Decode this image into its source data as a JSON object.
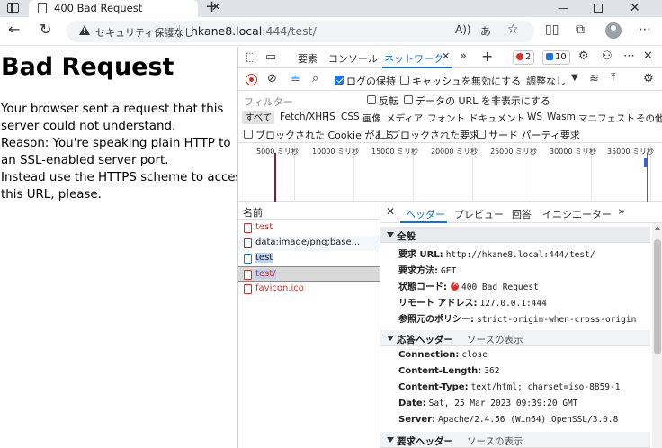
{
  "browser": {
    "tab_title": "400 Bad Request",
    "security_label": "セキュリティ保護なし",
    "url_host": "hkane8.local",
    "url_rest": ":444/test/"
  },
  "page": {
    "heading": "Bad Request",
    "lines": [
      "Your browser sent a request that this",
      "server could not understand.",
      "Reason: You're speaking plain HTTP to",
      "an SSL-enabled server port.",
      "Instead use the HTTPS scheme to access",
      "this URL, please."
    ]
  },
  "devtools": {
    "tabs": [
      "要素",
      "コンソール",
      "ネットワーク"
    ],
    "error_count": "2",
    "message_count": "10",
    "toolbar": {
      "preserve_log": "ログの保持",
      "disable_cache": "キャッシュを無効にする",
      "throttle": "調整なし"
    },
    "filter": {
      "placeholder": "フィルター",
      "invert": "反転",
      "hide_data_urls": "データの URL を非表示にする"
    },
    "types": [
      "すべて",
      "Fetch/XHR",
      "JS",
      "CSS",
      "画像",
      "メディア",
      "フォント",
      "ドキュメント",
      "WS",
      "Wasm",
      "マニフェスト",
      "その他"
    ],
    "blocked": {
      "cookies": "ブロックされた Cookie がある",
      "requests": "ブロックされた要求",
      "third_party": "サード パーティ要求"
    },
    "overview_labels": [
      "5000 ミリ秒",
      "10000 ミリ秒",
      "15000 ミリ秒",
      "20000 ミリ秒",
      "25000 ミリ秒",
      "30000 ミリ秒",
      "35000 ミリ秒"
    ],
    "requests": {
      "column": "名前",
      "rows": [
        "test",
        "data:image/png;base...",
        "test",
        "test/",
        "favicon.ico"
      ]
    },
    "detail": {
      "tabs": [
        "ヘッダー",
        "プレビュー",
        "回答",
        "イニシエーター"
      ],
      "general": {
        "title": "全般",
        "request_url_key": "要求 URL:",
        "request_url": "http://hkane8.local:444/test/",
        "method_key": "要求方法:",
        "method": "GET",
        "status_key": "状態コード:",
        "status": "400 Bad Request",
        "remote_key": "リモート アドレス:",
        "remote": "127.0.0.1:444",
        "referrer_key": "参照元のポリシー:",
        "referrer": "strict-origin-when-cross-origin"
      },
      "response_headers": {
        "title": "応答ヘッダー",
        "view_source": "ソースの表示",
        "items": [
          {
            "k": "Connection:",
            "v": "close"
          },
          {
            "k": "Content-Length:",
            "v": "362"
          },
          {
            "k": "Content-Type:",
            "v": "text/html; charset=iso-8859-1"
          },
          {
            "k": "Date:",
            "v": "Sat, 25 Mar 2023 09:39:20 GMT"
          },
          {
            "k": "Server:",
            "v": "Apache/2.4.56 (Win64) OpenSSL/3.0.8"
          }
        ]
      },
      "request_headers": {
        "title": "要求ヘッダー",
        "view_source": "ソースの表示"
      }
    }
  }
}
